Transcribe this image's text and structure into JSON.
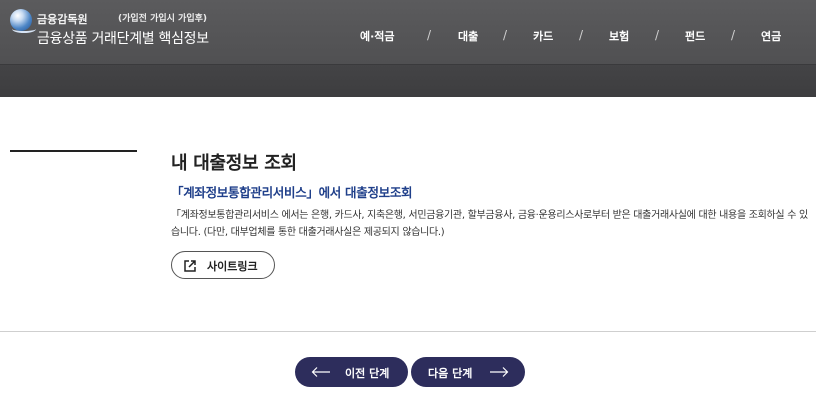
{
  "header": {
    "org_name": "금융감독원",
    "stage_tags": "(가입전  가입시  가입후)",
    "site_title": "금융상품 거래단계별 핵심정보",
    "nav": [
      "예·적금",
      "대출",
      "카드",
      "보험",
      "펀드",
      "연금"
    ],
    "nav_separator": "/"
  },
  "main": {
    "page_title": "내 대출정보 조회",
    "sub_title": "「계좌정보통합관리서비스」에서 대출정보조회",
    "description": "「계좌정보통합관리서비스 에서는 은행, 카드사, 지축은행, 서민금융기관, 할부금융사, 금융·운용리스사로부터 받은 대출거래사실에 대한 내용을 조회하실 수 있습니다. (다만, 대부업체를 통한 대출거래사실은 제공되지 않습니다.)",
    "site_link_label": "사이트링크"
  },
  "footer": {
    "prev_label": "이전 단계",
    "next_label": "다음 단계"
  },
  "colors": {
    "header_bg": "#505052",
    "subtitle_blue": "#1f3f8a",
    "button_navy": "#2d2d5c"
  }
}
